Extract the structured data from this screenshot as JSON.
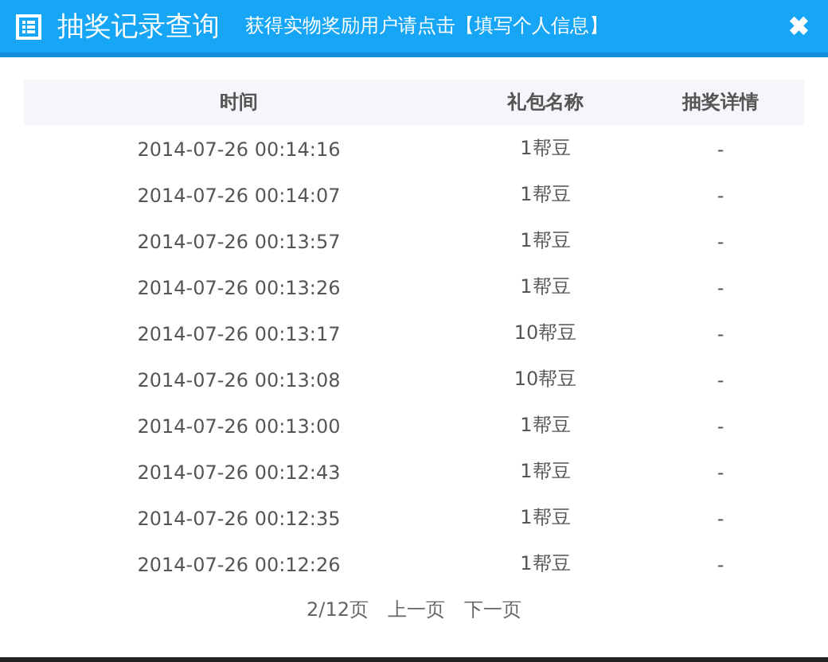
{
  "window": {
    "title": "抽奖记录查询",
    "subtitle": "获得实物奖励用户请点击【填写个人信息】",
    "close": "✖"
  },
  "table": {
    "columns": [
      "时间",
      "礼包名称",
      "抽奖详情"
    ],
    "rows": [
      [
        "2014-07-26 00:14:16",
        "1帮豆",
        "-"
      ],
      [
        "2014-07-26 00:14:07",
        "1帮豆",
        "-"
      ],
      [
        "2014-07-26 00:13:57",
        "1帮豆",
        "-"
      ],
      [
        "2014-07-26 00:13:26",
        "1帮豆",
        "-"
      ],
      [
        "2014-07-26 00:13:17",
        "10帮豆",
        "-"
      ],
      [
        "2014-07-26 00:13:08",
        "10帮豆",
        "-"
      ],
      [
        "2014-07-26 00:13:00",
        "1帮豆",
        "-"
      ],
      [
        "2014-07-26 00:12:43",
        "1帮豆",
        "-"
      ],
      [
        "2014-07-26 00:12:35",
        "1帮豆",
        "-"
      ],
      [
        "2014-07-26 00:12:26",
        "1帮豆",
        "-"
      ]
    ]
  },
  "pagination": {
    "page": "2/12页",
    "prev": "上一页",
    "next": "下一页"
  }
}
